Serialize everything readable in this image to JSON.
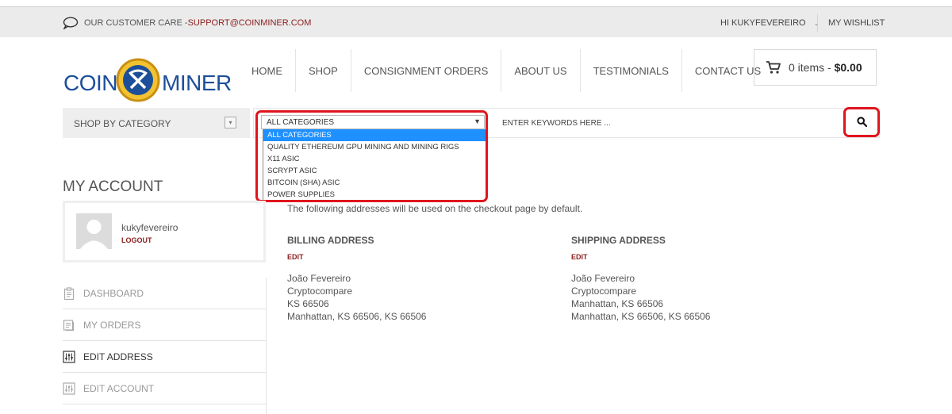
{
  "topbar": {
    "care_label": "OUR CUSTOMER CARE -",
    "care_email": "SUPPORT@COINMINER.COM",
    "user_greeting": "HI KUKYFEVEREIRO",
    "wishlist": "MY WISHLIST"
  },
  "logo": {
    "word1": "COIN",
    "word2": "MINER"
  },
  "nav": [
    "HOME",
    "SHOP",
    "CONSIGNMENT ORDERS",
    "ABOUT US",
    "TESTIMONIALS",
    "CONTACT US"
  ],
  "cart": {
    "items": "0 items",
    "separator": " - ",
    "total": "$0.00"
  },
  "category_bar": {
    "label": "SHOP BY CATEGORY"
  },
  "search": {
    "category_selected": "ALL CATEGORIES",
    "category_options": [
      "ALL CATEGORIES",
      "QUALITY ETHEREUM GPU MINING AND MINING RIGS",
      "X11 ASIC",
      "SCRYPT ASIC",
      "BITCOIN (SHA) ASIC",
      "POWER SUPPLIES"
    ],
    "keywords_placeholder": "ENTER KEYWORDS HERE ..."
  },
  "account": {
    "title": "MY ACCOUNT",
    "username": "kukyfevereiro",
    "logout": "LOGOUT",
    "menu": [
      {
        "label": "DASHBOARD",
        "icon": "clipboard-icon",
        "active": false
      },
      {
        "label": "MY ORDERS",
        "icon": "orders-icon",
        "active": false
      },
      {
        "label": "EDIT ADDRESS",
        "icon": "sliders-icon",
        "active": true
      },
      {
        "label": "EDIT ACCOUNT",
        "icon": "sliders-icon",
        "active": false
      }
    ]
  },
  "addresses": {
    "intro": "The following addresses will be used on the checkout page by default.",
    "billing": {
      "title": "BILLING ADDRESS",
      "edit": "EDIT",
      "lines": [
        "João Fevereiro",
        "Cryptocompare",
        "KS 66506",
        "Manhattan, KS 66506, KS 66506"
      ]
    },
    "shipping": {
      "title": "SHIPPING ADDRESS",
      "edit": "EDIT",
      "lines": [
        "João Fevereiro",
        "Cryptocompare",
        "Manhattan, KS 66506",
        "Manhattan, KS 66506, KS 66506"
      ]
    }
  },
  "colors": {
    "accent_red": "#8b1d1d",
    "logo_blue": "#1c4f99",
    "highlight": "#1e90ff",
    "annotation": "#e0141e"
  }
}
